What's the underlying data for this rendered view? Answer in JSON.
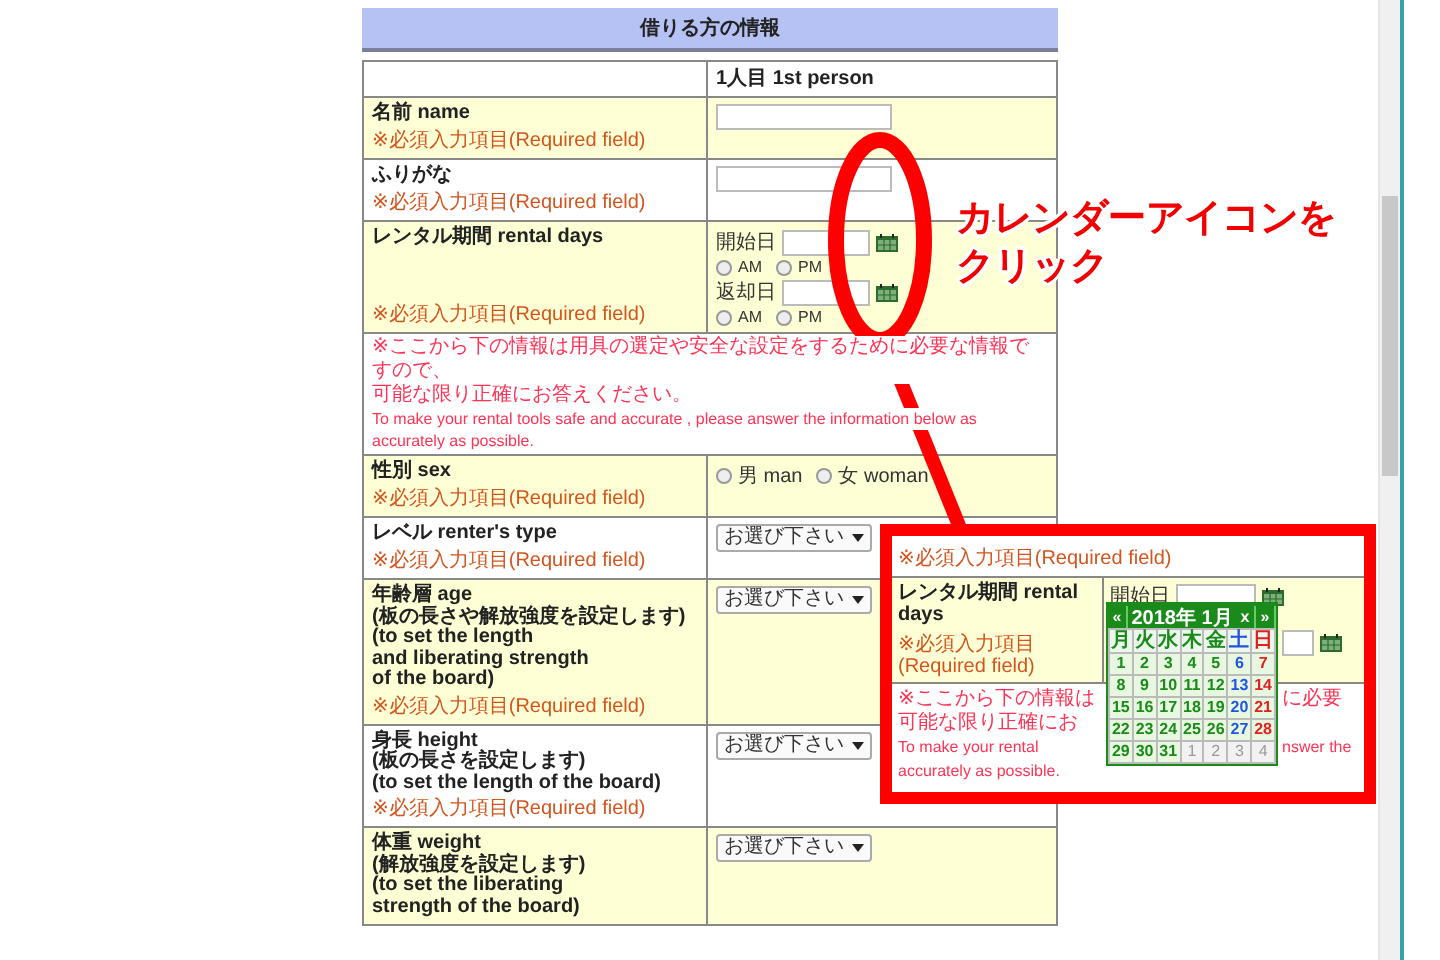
{
  "header": {
    "title": "借りる方の情報"
  },
  "table": {
    "column_header": "1人目 1st person",
    "rows": [
      {
        "kind": "text",
        "label_lines": [
          "名前 name"
        ],
        "required_note": "※必須入力項目(Required field)"
      },
      {
        "kind": "text",
        "label_lines": [
          "ふりがな"
        ],
        "required_note": "※必須入力項目(Required field)"
      },
      {
        "kind": "dates",
        "label_lines": [
          "レンタル期間 rental days"
        ],
        "required_note": "※必須入力項目(Required field)",
        "dates": [
          {
            "label": "開始日",
            "options": [
              {
                "label": "AM",
                "selected": false
              },
              {
                "label": "PM",
                "selected": false
              }
            ]
          },
          {
            "label": "返却日",
            "options": [
              {
                "label": "AM",
                "selected": false
              },
              {
                "label": "PM",
                "selected": false
              }
            ]
          }
        ]
      },
      {
        "kind": "notice",
        "lines": [
          "※ここから下の情報は用具の選定や安全な設定をするために必要な情報ですので、",
          "可能な限り正確にお答えください。",
          "To make your rental tools safe and accurate , please answer the information below as",
          "accurately as possible."
        ]
      },
      {
        "kind": "radio",
        "label_lines": [
          "性別 sex"
        ],
        "required_note": "※必須入力項目(Required field)",
        "options": [
          {
            "label": "男 man",
            "selected": false
          },
          {
            "label": "女 woman",
            "selected": false
          }
        ]
      },
      {
        "kind": "select",
        "label_lines": [
          "レベル renter's type"
        ],
        "required_note": "※必須入力項目(Required field)",
        "value": "お選び下さい"
      },
      {
        "kind": "select",
        "label_lines": [
          "年齢層 age",
          "(板の長さや解放強度を設定します)",
          "(to set the length",
          "and liberating strength",
          "of the board)"
        ],
        "required_note": "※必須入力項目(Required field)",
        "value": "お選び下さい"
      },
      {
        "kind": "select",
        "label_lines": [
          "身長 height",
          "(板の長さを設定します)",
          "(to set the length of the board)"
        ],
        "required_note": "※必須入力項目(Required field)",
        "value": "お選び下さい"
      },
      {
        "kind": "select",
        "label_lines": [
          "体重 weight",
          "(解放強度を設定します)",
          "(to set the liberating",
          "strength of the board)"
        ],
        "value": "お選び下さい"
      }
    ]
  },
  "callout": {
    "lines": [
      "カレンダーアイコンを",
      "クリック"
    ]
  },
  "inset": {
    "top_note": "※必須入力項目(Required field)",
    "label": "レンタル期間 rental days",
    "required_note": "※必須入力項目(Required field)",
    "start_label": "開始日",
    "calendar": {
      "title": "2018年 1月",
      "prev": "«",
      "close": "x",
      "next": "»",
      "weekdays": [
        {
          "label": "月",
          "color": "#1a8a1a"
        },
        {
          "label": "火",
          "color": "#1a8a1a"
        },
        {
          "label": "水",
          "color": "#1a8a1a"
        },
        {
          "label": "木",
          "color": "#1a8a1a"
        },
        {
          "label": "金",
          "color": "#1a8a1a"
        },
        {
          "label": "土",
          "color": "#2255dd"
        },
        {
          "label": "日",
          "color": "#dd2222"
        }
      ],
      "weeks": [
        [
          {
            "text": "1",
            "kind": "current",
            "color": "#1a8a1a"
          },
          {
            "text": "2",
            "kind": "current",
            "color": "#1a8a1a"
          },
          {
            "text": "3",
            "kind": "current",
            "color": "#1a8a1a"
          },
          {
            "text": "4",
            "kind": "current",
            "color": "#1a8a1a"
          },
          {
            "text": "5",
            "kind": "current",
            "color": "#1a8a1a"
          },
          {
            "text": "6",
            "kind": "current",
            "color": "#2255dd"
          },
          {
            "text": "7",
            "kind": "current",
            "color": "#dd2222"
          }
        ],
        [
          {
            "text": "8",
            "kind": "current",
            "color": "#1a8a1a"
          },
          {
            "text": "9",
            "kind": "current",
            "color": "#1a8a1a"
          },
          {
            "text": "10",
            "kind": "current",
            "color": "#1a8a1a"
          },
          {
            "text": "11",
            "kind": "current",
            "color": "#1a8a1a"
          },
          {
            "text": "12",
            "kind": "current",
            "color": "#1a8a1a"
          },
          {
            "text": "13",
            "kind": "current",
            "color": "#2255dd"
          },
          {
            "text": "14",
            "kind": "current",
            "color": "#dd2222"
          }
        ],
        [
          {
            "text": "15",
            "kind": "current",
            "color": "#1a8a1a"
          },
          {
            "text": "16",
            "kind": "current",
            "color": "#1a8a1a"
          },
          {
            "text": "17",
            "kind": "current",
            "color": "#1a8a1a"
          },
          {
            "text": "18",
            "kind": "current",
            "color": "#1a8a1a"
          },
          {
            "text": "19",
            "kind": "current",
            "color": "#1a8a1a"
          },
          {
            "text": "20",
            "kind": "current",
            "color": "#2255dd"
          },
          {
            "text": "21",
            "kind": "current",
            "color": "#dd2222"
          }
        ],
        [
          {
            "text": "22",
            "kind": "current",
            "color": "#1a8a1a"
          },
          {
            "text": "23",
            "kind": "current",
            "color": "#1a8a1a"
          },
          {
            "text": "24",
            "kind": "current",
            "color": "#1a8a1a"
          },
          {
            "text": "25",
            "kind": "current",
            "color": "#1a8a1a"
          },
          {
            "text": "26",
            "kind": "current",
            "color": "#1a8a1a"
          },
          {
            "text": "27",
            "kind": "current",
            "color": "#2255dd"
          },
          {
            "text": "28",
            "kind": "current",
            "color": "#dd2222"
          }
        ],
        [
          {
            "text": "29",
            "kind": "current",
            "color": "#1a8a1a"
          },
          {
            "text": "30",
            "kind": "current",
            "color": "#1a8a1a"
          },
          {
            "text": "31",
            "kind": "current",
            "color": "#1a8a1a"
          },
          {
            "text": "1",
            "kind": "other",
            "color": "#999999"
          },
          {
            "text": "2",
            "kind": "other",
            "color": "#999999"
          },
          {
            "text": "3",
            "kind": "other",
            "color": "#999999"
          },
          {
            "text": "4",
            "kind": "other",
            "color": "#999999"
          }
        ]
      ]
    },
    "notice_lines": [
      {
        "kind": "cjk",
        "left": "※ここから下の情報は",
        "right": "に必要"
      },
      {
        "kind": "cjk",
        "left": "可能な限り正確にお"
      },
      {
        "kind": "latin",
        "left": "To make your rental",
        "right": "nswer the"
      },
      {
        "kind": "latin",
        "left": "accurately as possible."
      }
    ]
  }
}
